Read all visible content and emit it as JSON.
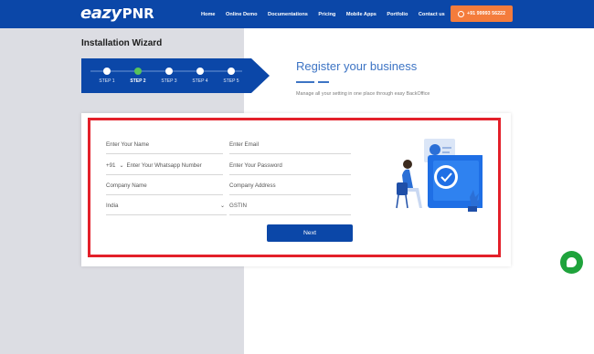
{
  "brand": {
    "logo_part1": "eazy",
    "logo_part2": "PNR"
  },
  "nav": {
    "links": [
      "Home",
      "Online Demo",
      "Documentations",
      "Pricing",
      "Mobile Apps",
      "Portfolio",
      "Contact us"
    ],
    "phone_label": "+91 99993 56222"
  },
  "wizard": {
    "title": "Installation Wizard",
    "steps": [
      "STEP 1",
      "STEP 2",
      "STEP 3",
      "STEP 4",
      "STEP 5"
    ],
    "active_step": 2
  },
  "register": {
    "title": "Register your business",
    "subtitle": "Manage all your setting in one place through easy BackOffice"
  },
  "form": {
    "name_placeholder": "Enter Your Name",
    "email_placeholder": "Enter Email",
    "country_code": "+91",
    "whatsapp_placeholder": "Enter Your Whatsapp Number",
    "password_placeholder": "Enter Your Password",
    "company_name_placeholder": "Company Name",
    "company_address_placeholder": "Company Address",
    "country_value": "India",
    "gstin_placeholder": "GSTIN",
    "next_label": "Next"
  },
  "colors": {
    "nav_bg": "#0b47a8",
    "accent_orange": "#f47c3c",
    "step_active": "#57c35a",
    "highlight_frame": "#e3202a",
    "chat_green": "#1fa33c"
  },
  "icons": {
    "phone_button_icon": "whatsapp-icon",
    "dropdown_icon": "chevron-down-icon",
    "chat_icon": "chat-bubble-icon"
  }
}
